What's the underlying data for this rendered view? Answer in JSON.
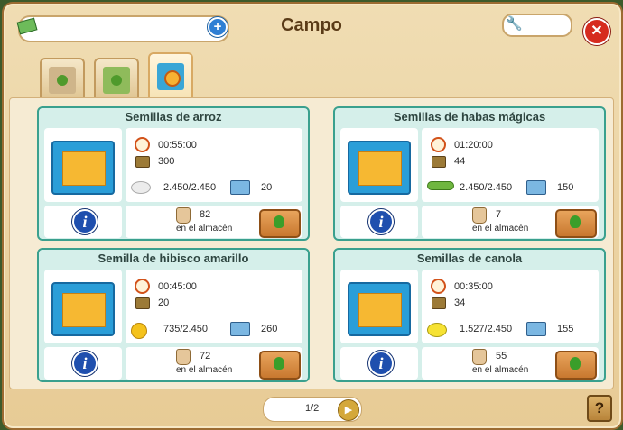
{
  "header": {
    "title": "Campo",
    "cash_value": "",
    "tool_value": "",
    "add_label": "+",
    "close_label": "✕"
  },
  "tabs": [
    {
      "name": "seed-bag-plain"
    },
    {
      "name": "seed-bag-green"
    },
    {
      "name": "seed-bag-timer",
      "active": true
    }
  ],
  "cards": [
    {
      "title": "Semillas de arroz",
      "time": "00:55:00",
      "xp": "300",
      "crop": "rice",
      "yield": "2.450/2.450",
      "price": "20",
      "stored": "82",
      "stored_label": "en el almacén"
    },
    {
      "title": "Semillas de habas mágicas",
      "time": "01:20:00",
      "xp": "44",
      "crop": "bean",
      "yield": "2.450/2.450",
      "price": "150",
      "stored": "7",
      "stored_label": "en el almacén"
    },
    {
      "title": "Semilla de hibisco amarillo",
      "time": "00:45:00",
      "xp": "20",
      "crop": "hibiscus",
      "yield": "735/2.450",
      "price": "260",
      "stored": "72",
      "stored_label": "en el almacén"
    },
    {
      "title": "Semillas de canola",
      "time": "00:35:00",
      "xp": "34",
      "crop": "canola",
      "yield": "1.527/2.450",
      "price": "155",
      "stored": "55",
      "stored_label": "en el almacén"
    }
  ],
  "pager": {
    "label": "1/2",
    "next_label": "▶"
  },
  "help_label": "?",
  "colors": {
    "card_border": "#3aa08e",
    "card_bg": "#d5efea",
    "frame": "#e7cb95",
    "close": "#d62b1f"
  }
}
